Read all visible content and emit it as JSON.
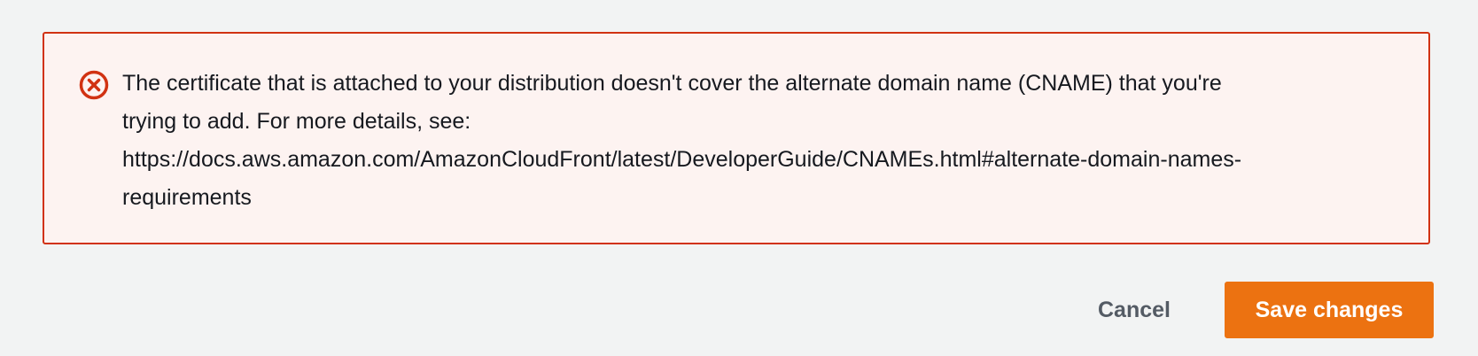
{
  "alert": {
    "type": "error",
    "icon": "error-circle-x-icon",
    "color": "#d13212",
    "background": "#fdf3f1",
    "lines": [
      "The certificate that is attached to your distribution doesn't cover the alternate domain name (CNAME) that you're",
      "trying to add. For more details, see:",
      "https://docs.aws.amazon.com/AmazonCloudFront/latest/DeveloperGuide/CNAMEs.html#alternate-domain-names-",
      "requirements"
    ]
  },
  "actions": {
    "cancel_label": "Cancel",
    "save_label": "Save changes",
    "save_color": "#ec7211"
  }
}
